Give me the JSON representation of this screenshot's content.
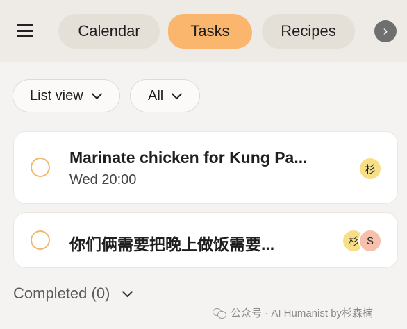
{
  "tabs": {
    "calendar": "Calendar",
    "tasks": "Tasks",
    "recipes": "Recipes"
  },
  "filters": {
    "view": "List view",
    "scope": "All"
  },
  "tasks": [
    {
      "title": "Marinate chicken for Kung Pa...",
      "time": "Wed  20:00",
      "assignees": [
        "杉"
      ]
    },
    {
      "title": "你们俩需要把晚上做饭需要...",
      "assignees": [
        "杉",
        "S"
      ]
    }
  ],
  "completed_label": "Completed (0)",
  "watermark": "公众号 · AI Humanist by杉森楠",
  "icons": [
    "hamburger-menu-icon",
    "chevron-right-icon",
    "chevron-down-icon",
    "checkbox-circle-icon",
    "wechat-icon"
  ],
  "colors": {
    "accent": "#fbb66d",
    "checkbox": "#f0b76f",
    "avatar_yellow": "#f7df87",
    "avatar_pink": "#f7c0ad"
  }
}
